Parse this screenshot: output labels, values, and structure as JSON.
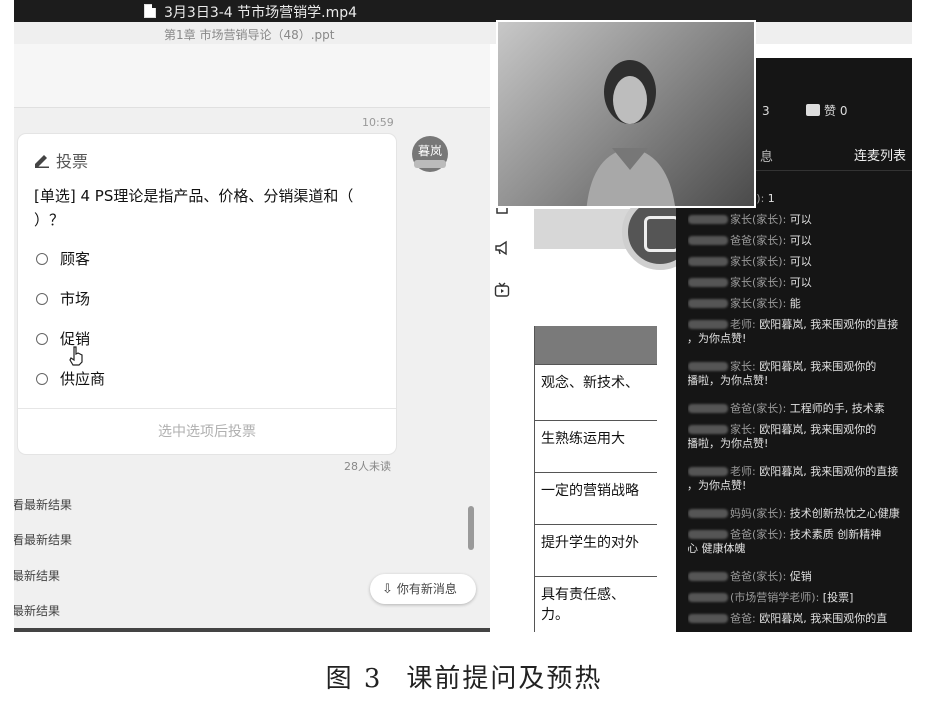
{
  "window": {
    "title": "3月3日3-4 节市场营销学.mp4",
    "document": "第1章 市场营销导论（48）.ppt"
  },
  "chat": {
    "timestamp": "10:59",
    "avatar_label": "暮岚",
    "vote": {
      "header": "投票",
      "question": "[单选] 4 PS理论是指产品、价格、分销渠道和（ ）？",
      "options": [
        "顾客",
        "市场",
        "促销",
        "供应商"
      ],
      "submit_label": "选中选项后投票"
    },
    "unread": "28人未读",
    "result_links": [
      "看最新结果",
      "看最新结果",
      "最新结果",
      "最新结果"
    ],
    "new_message": "你有新消息"
  },
  "slide": {
    "cells": [
      "观念、新技术、",
      "生熟练运用大",
      "一定的营销战略",
      "提升学生的对外",
      "具有责任感、\n力。"
    ]
  },
  "live": {
    "count": "3",
    "like_label": "赞",
    "like_count": "0",
    "tab_chat": "息",
    "tab_mic": "连麦列表",
    "messages": [
      {
        "who": "(家长):",
        "text": " 1"
      },
      {
        "who": "家长(家长):",
        "text": " 可以"
      },
      {
        "who": "爸爸(家长):",
        "text": " 可以"
      },
      {
        "who": "家长(家长):",
        "text": " 可以"
      },
      {
        "who": "家长(家长):",
        "text": " 可以"
      },
      {
        "who": "家长(家长):",
        "text": " 能"
      },
      {
        "who": "老师:",
        "text": " 欧阳暮岚, 我来围观你的直接",
        "cont": "啦，为你点赞!"
      },
      {
        "who": "家长:",
        "text": " 欧阳暮岚, 我来围观你的",
        "cont": "直播啦，为你点赞!"
      },
      {
        "who": "爸爸(家长):",
        "text": " 工程师的手, 技术素"
      },
      {
        "who": "家长:",
        "text": " 欧阳暮岚, 我来围观你的",
        "cont": "直播啦，为你点赞!"
      },
      {
        "who": "老师:",
        "text": " 欧阳暮岚, 我来围观你的直接",
        "cont": "啦，为你点赞!"
      },
      {
        "who": "妈妈(家长):",
        "text": " 技术创新热忱之心健康"
      },
      {
        "who": "爸爸(家长):",
        "text": " 技术素质  创新精神",
        "cont": "之心  健康体魄"
      },
      {
        "who": "爸爸(家长):",
        "text": " 促销"
      },
      {
        "who": "(市场营销学老师):",
        "text": " [投票]"
      },
      {
        "who": "爸爸:",
        "text": " 欧阳暮岚, 我来围观你的直"
      }
    ]
  },
  "caption": {
    "figure": "图 3",
    "text": "课前提问及预热"
  }
}
